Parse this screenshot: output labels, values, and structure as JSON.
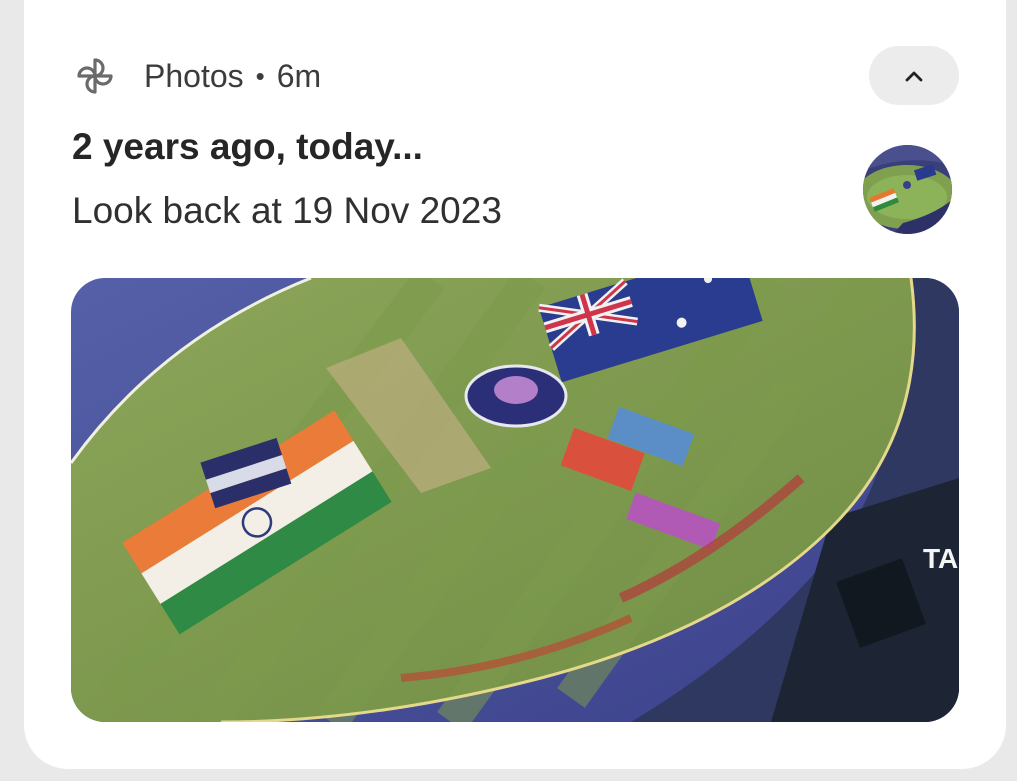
{
  "notification": {
    "app_name": "Photos",
    "separator": "•",
    "time_ago": "6m",
    "title": "2 years ago, today...",
    "text": "Look back at 19 Nov 2023",
    "icons": {
      "app": "pinwheel-icon",
      "collapse": "chevron-up-icon"
    }
  },
  "colors": {
    "background": "#e9e9ea",
    "card": "#ffffff",
    "button": "#ececec",
    "text_primary": "#262626",
    "text_secondary": "#3c3c3c"
  }
}
